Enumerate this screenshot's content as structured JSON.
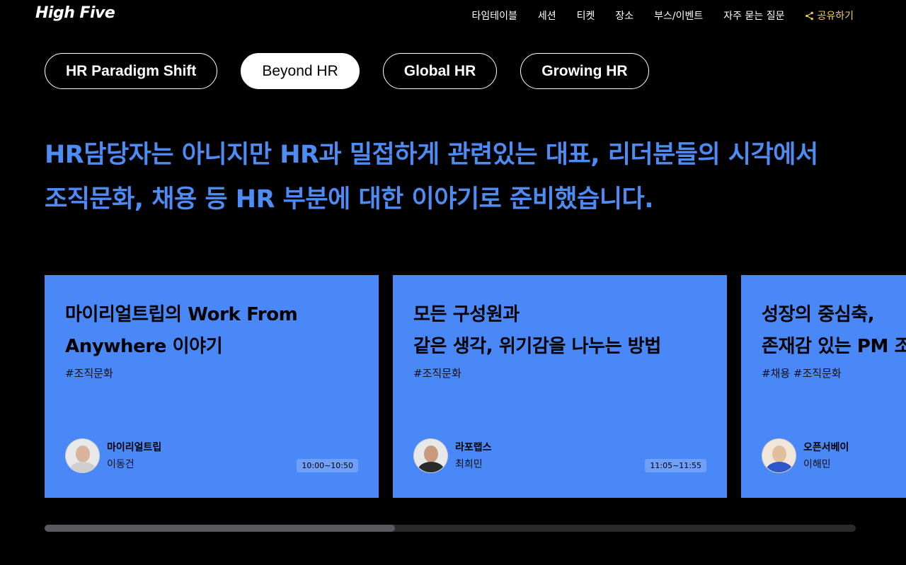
{
  "header": {
    "logo": "High Five",
    "nav": [
      "타임테이블",
      "세션",
      "티켓",
      "장소",
      "부스/이벤트",
      "자주 묻는 질문"
    ],
    "share_label": "공유하기",
    "share_color": "#f5d24a"
  },
  "tabs": [
    {
      "label": "HR Paradigm Shift",
      "active": false
    },
    {
      "label": "Beyond HR",
      "active": true
    },
    {
      "label": "Global HR",
      "active": false
    },
    {
      "label": "Growing HR",
      "active": false
    }
  ],
  "headline": {
    "line1": "HR담당자는 아니지만 HR과 밀접하게 관련있는 대표, 리더분들의 시각에서",
    "line2": "조직문화, 채용 등 HR 부분에 대한 이야기로 준비했습니다.",
    "color": "#4d8bf5"
  },
  "sessions": [
    {
      "title": "마이리얼트립의 Work From\nAnywhere 이야기",
      "tags": "#조직문화",
      "company": "마이리얼트립",
      "speaker": "이동건",
      "time": "10:00~10:50"
    },
    {
      "title": "모든 구성원과\n같은 생각, 위기감을 나누는 방법",
      "tags": "#조직문화",
      "company": "라포랩스",
      "speaker": "최희민",
      "time": "11:05~11:55"
    },
    {
      "title": "성장의 중심축,\n존재감 있는 PM 조",
      "tags": "#채용 #조직문화",
      "company": "오픈서베이",
      "speaker": "이해민",
      "time": ""
    }
  ],
  "colors": {
    "card": "#4a88f7",
    "background": "#000000"
  },
  "scroll": {
    "position_fraction": 0.43
  }
}
